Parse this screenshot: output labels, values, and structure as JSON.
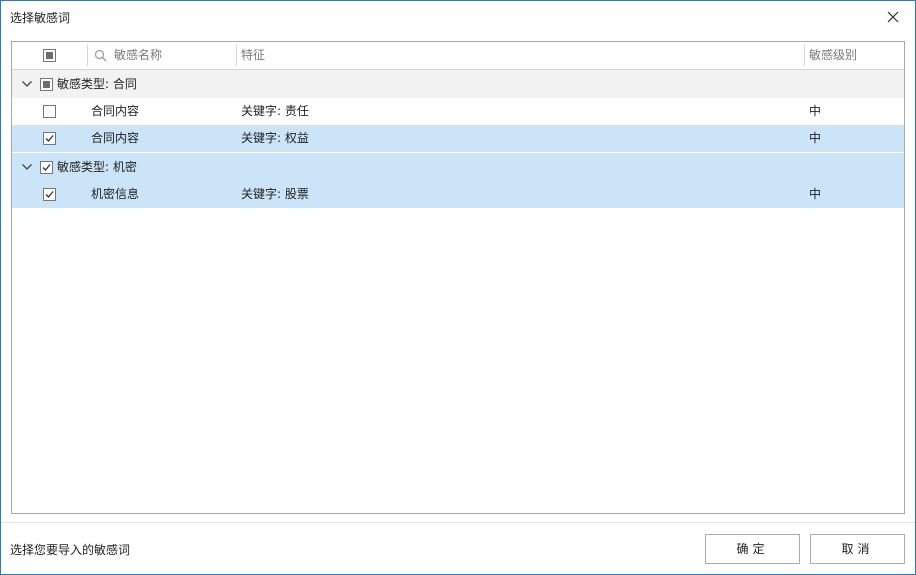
{
  "window": {
    "title": "选择敏感词"
  },
  "grid": {
    "columns": {
      "name_placeholder": "敏感名称",
      "feature": "特征",
      "level": "敏感级别"
    },
    "groups": [
      {
        "label": "敏感类型: 合同",
        "check_state": "partial",
        "items": [
          {
            "name": "合同内容",
            "feature": "关键字: 责任",
            "level": "中",
            "checked": false,
            "selected": false
          },
          {
            "name": "合同内容",
            "feature": "关键字: 权益",
            "level": "中",
            "checked": true,
            "selected": true
          }
        ]
      },
      {
        "label": "敏感类型: 机密",
        "check_state": "checked",
        "items": [
          {
            "name": "机密信息",
            "feature": "关键字: 股票",
            "level": "中",
            "checked": true,
            "selected": true
          }
        ]
      }
    ]
  },
  "footer": {
    "status": "选择您要导入的敏感词",
    "ok_label": "确定",
    "cancel_label": "取消"
  },
  "colors": {
    "selection": "#cce4f7",
    "group_row": "#f2f2f2",
    "border": "#2b78c5"
  }
}
